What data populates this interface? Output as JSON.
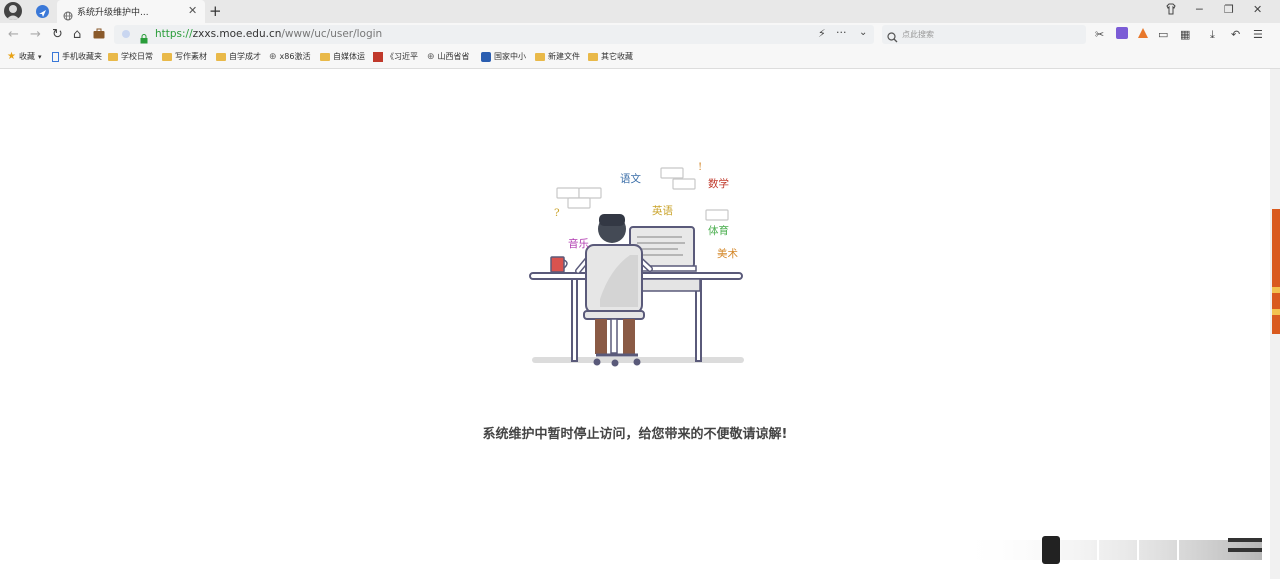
{
  "tab": {
    "title": "系统升级维护中..."
  },
  "address_bar": {
    "scheme": "https://",
    "host": "zxxs.moe.edu.cn",
    "path": "/www/uc/user/login"
  },
  "search": {
    "placeholder": "点此搜索"
  },
  "bookmarks": [
    "收藏",
    "手机收藏夹",
    "学校日常",
    "写作素材",
    "自学成才",
    "x86激活",
    "自媒体运",
    "《习近平",
    "山西省省",
    "国家中小",
    "新建文件",
    "其它收藏"
  ],
  "illustration": {
    "subjects": [
      "语文",
      "数学",
      "英语",
      "体育",
      "音乐",
      "美术"
    ],
    "marks": [
      "?",
      "!"
    ]
  },
  "message": "系统维护中暂时停止访问，给您带来的不便敬请谅解!",
  "colors": {
    "subject_chinese": "#3a6ea8",
    "subject_math": "#c0392b",
    "subject_english": "#c9a227",
    "subject_pe": "#4caf50",
    "subject_music": "#b03ab0",
    "subject_art": "#d4882b"
  }
}
